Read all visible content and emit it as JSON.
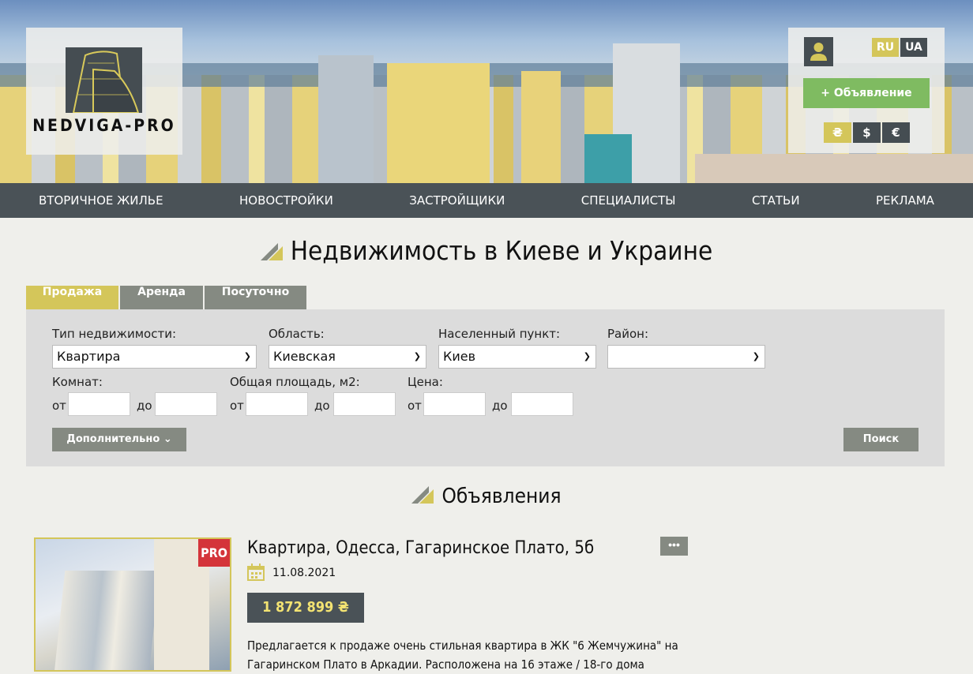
{
  "logo": {
    "text": "NEDVIGA-PRO"
  },
  "header": {
    "languages": [
      {
        "label": "RU",
        "active": true
      },
      {
        "label": "UA",
        "active": false
      }
    ],
    "add_listing_label": "+ Объявление",
    "currencies": [
      {
        "label": "₴",
        "active": true
      },
      {
        "label": "$",
        "active": false
      },
      {
        "label": "€",
        "active": false
      }
    ]
  },
  "nav": [
    "ВТОРИЧНОЕ ЖИЛЬЕ",
    "НОВОСТРОЙКИ",
    "ЗАСТРОЙЩИКИ",
    "СПЕЦИАЛИСТЫ",
    "СТАТЬИ",
    "РЕКЛАМА"
  ],
  "page_title": "Недвижимость в Киеве и Украине",
  "tabs": [
    {
      "label": "Продажа",
      "active": true
    },
    {
      "label": "Аренда",
      "active": false
    },
    {
      "label": "Посуточно",
      "active": false
    }
  ],
  "search": {
    "property_type": {
      "label": "Тип недвижимости:",
      "value": "Квартира"
    },
    "region": {
      "label": "Область:",
      "value": "Киевская"
    },
    "city": {
      "label": "Населенный пункт:",
      "value": "Киев"
    },
    "district": {
      "label": "Район:",
      "value": ""
    },
    "rooms": {
      "label": "Комнат:",
      "from": "от",
      "to": "до"
    },
    "area": {
      "label": "Общая площадь, м2:",
      "from": "от",
      "to": "до"
    },
    "price": {
      "label": "Цена:",
      "from": "от",
      "to": "до"
    },
    "more_label": "Дополнительно",
    "search_label": "Поиск"
  },
  "listings_title": "Объявления",
  "listing": {
    "badge": "PRO",
    "title": "Квартира, Одесса, Гагаринское Плато, 5б",
    "date": "11.08.2021",
    "price": "1 872 899 ₴",
    "more": "•••",
    "description": "Предлагается к продаже очень стильная квартира в ЖК \"6 Жемчужина\" на Гагаринском Плато в Аркадии. Расположена на 16 этаже / 18-го дома"
  },
  "colors": {
    "accent": "#d4c65a",
    "nav": "#4a5257",
    "green": "#7fbb61",
    "gray": "#858a82",
    "pro": "#d4343a"
  }
}
